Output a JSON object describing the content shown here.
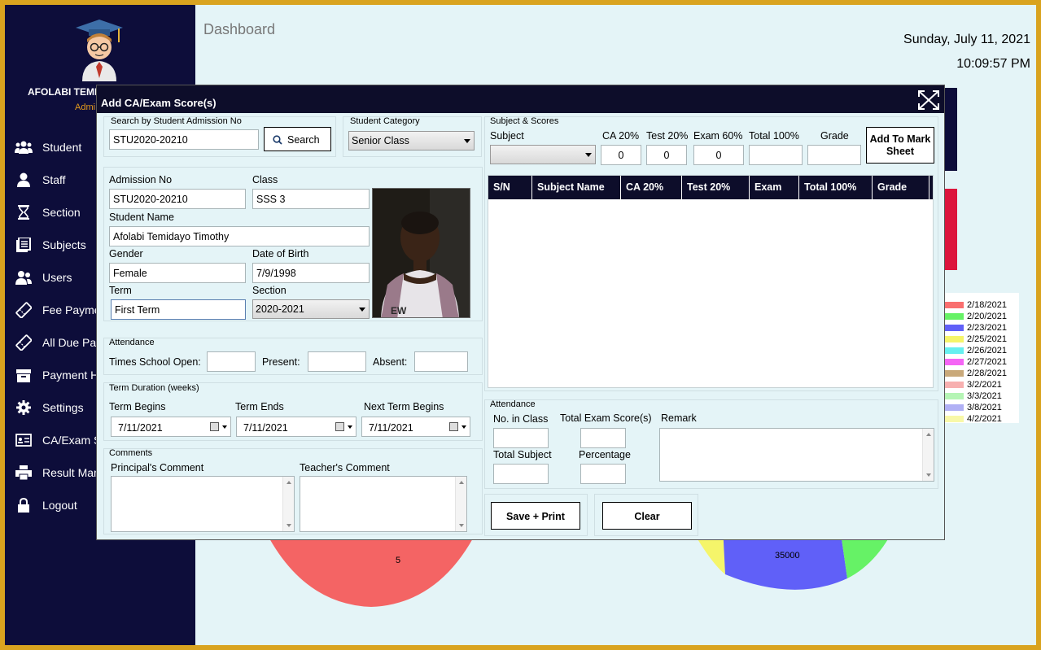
{
  "sidebar": {
    "user_name": "AFOLABI TEMI",
    "user_role": "Admi",
    "items": [
      {
        "label": "Student",
        "icon": "users-icon"
      },
      {
        "label": "Staff",
        "icon": "user-icon"
      },
      {
        "label": "Section",
        "icon": "hourglass-icon"
      },
      {
        "label": "Subjects",
        "icon": "book-icon"
      },
      {
        "label": "Users",
        "icon": "users-group-icon"
      },
      {
        "label": "Fee Payme",
        "icon": "ticket-icon"
      },
      {
        "label": "All Due Pay",
        "icon": "ticket-icon"
      },
      {
        "label": "Payment H",
        "icon": "archive-icon"
      },
      {
        "label": "Settings",
        "icon": "gear-icon"
      },
      {
        "label": "CA/Exam S",
        "icon": "id-card-icon"
      },
      {
        "label": "Result Man",
        "icon": "printer-icon"
      },
      {
        "label": "Logout",
        "icon": "lock-icon"
      }
    ]
  },
  "dashboard": {
    "title": "Dashboard",
    "date": "Sunday, July 11, 2021",
    "time": "10:09:57 PM",
    "legend": [
      {
        "label": "2/18/2021",
        "color": "#f96f6f"
      },
      {
        "label": "2/20/2021",
        "color": "#66f266"
      },
      {
        "label": "2/23/2021",
        "color": "#6060f8"
      },
      {
        "label": "2/25/2021",
        "color": "#f5f56a"
      },
      {
        "label": "2/26/2021",
        "color": "#66f0f0"
      },
      {
        "label": "2/27/2021",
        "color": "#f565f5"
      },
      {
        "label": "2/28/2021",
        "color": "#c9a97a"
      },
      {
        "label": "3/2/2021",
        "color": "#f7b0b0"
      },
      {
        "label": "3/3/2021",
        "color": "#b5f5b5"
      },
      {
        "label": "3/8/2021",
        "color": "#b0b0f5"
      },
      {
        "label": "4/2/2021",
        "color": "#f8f8a8"
      }
    ],
    "pie_left_label": "5",
    "pie_right_label": "35000"
  },
  "modal": {
    "title": "Add CA/Exam Score(s)",
    "search": {
      "group_label": "Search by Student Admission No",
      "value": "STU2020-20210",
      "button": "Search"
    },
    "category": {
      "group_label": "Student Category",
      "value": "Senior Class"
    },
    "student": {
      "admission_label": "Admission No",
      "admission_value": "STU2020-20210",
      "class_label": "Class",
      "class_value": "SSS 3",
      "name_label": "Student Name",
      "name_value": "Afolabi Temidayo Timothy",
      "gender_label": "Gender",
      "gender_value": "Female",
      "dob_label": "Date of Birth",
      "dob_value": "7/9/1998",
      "term_label": "Term",
      "term_value": "First Term",
      "section_label": "Section",
      "section_value": "2020-2021"
    },
    "attendance": {
      "group_label": "Attendance",
      "times_open_label": "Times School Open:",
      "present_label": "Present:",
      "absent_label": "Absent:"
    },
    "term_duration": {
      "group_label": "Term Duration (weeks)",
      "begins_label": "Term Begins",
      "begins_value": "7/11/2021",
      "ends_label": "Term Ends",
      "ends_value": "7/11/2021",
      "next_label": "Next Term Begins",
      "next_value": "7/11/2021"
    },
    "comments": {
      "group_label": "Comments",
      "principal_label": "Principal's Comment",
      "teacher_label": "Teacher's Comment"
    },
    "scores": {
      "group_label": "Subject & Scores",
      "subject_label": "Subject",
      "ca_label": "CA 20%",
      "ca_value": "0",
      "test_label": "Test 20%",
      "test_value": "0",
      "exam_label": "Exam 60%",
      "exam_value": "0",
      "total_label": "Total 100%",
      "grade_label": "Grade",
      "add_button": "Add To Mark Sheet",
      "columns": [
        "S/N",
        "Subject Name",
        "CA 20%",
        "Test 20%",
        "Exam",
        "Total 100%",
        "Grade"
      ]
    },
    "summary": {
      "group_label": "Attendance",
      "no_in_class_label": "No. in Class",
      "total_exam_label": "Total Exam Score(s)",
      "remark_label": "Remark",
      "total_subject_label": "Total Subject",
      "percentage_label": "Percentage"
    },
    "actions": {
      "save_print": "Save + Print",
      "clear": "Clear"
    }
  }
}
